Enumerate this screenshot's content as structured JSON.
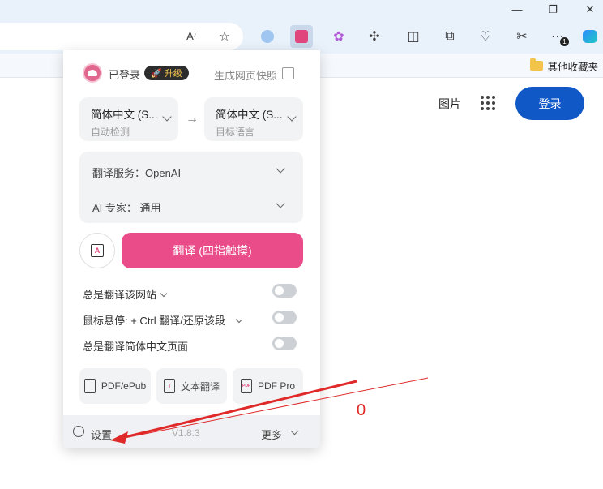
{
  "browser": {
    "window_controls": {
      "minimize": "—",
      "maximize": "❐",
      "close": "✕"
    },
    "favorites": {
      "other_folder": "其他收藏夹"
    },
    "extension_badge": "1"
  },
  "page": {
    "images_link": "图片",
    "login_button": "登录"
  },
  "popup": {
    "header": {
      "logged_in": "已登录",
      "upgrade": "升级",
      "snapshot": "生成网页快照"
    },
    "languages": {
      "source": {
        "title": "简体中文 (S...",
        "subtitle": "自动检测"
      },
      "target": {
        "title": "简体中文 (S...",
        "subtitle": "目标语言"
      },
      "swap_arrow": "→"
    },
    "service": {
      "label": "翻译服务：",
      "value": "OpenAI",
      "expert_label": "AI 专家：",
      "expert_value": "通用"
    },
    "translate_button": "翻译 (四指触摸)",
    "hover_icon_letter": "A",
    "options": [
      {
        "label": "总是翻译该网站"
      },
      {
        "label": "鼠标悬停:  + Ctrl 翻译/还原该段"
      },
      {
        "label": "总是翻译简体中文页面"
      }
    ],
    "tools": [
      {
        "label": "PDF/ePub"
      },
      {
        "label": "文本翻译",
        "icon_letter": "T"
      },
      {
        "label": "PDF Pro",
        "icon_letter": "PDF"
      }
    ],
    "footer": {
      "settings": "设置",
      "version": "V1.8.3",
      "more": "更多"
    }
  },
  "annotation": {
    "label": "0",
    "color": "#e02a2a"
  }
}
